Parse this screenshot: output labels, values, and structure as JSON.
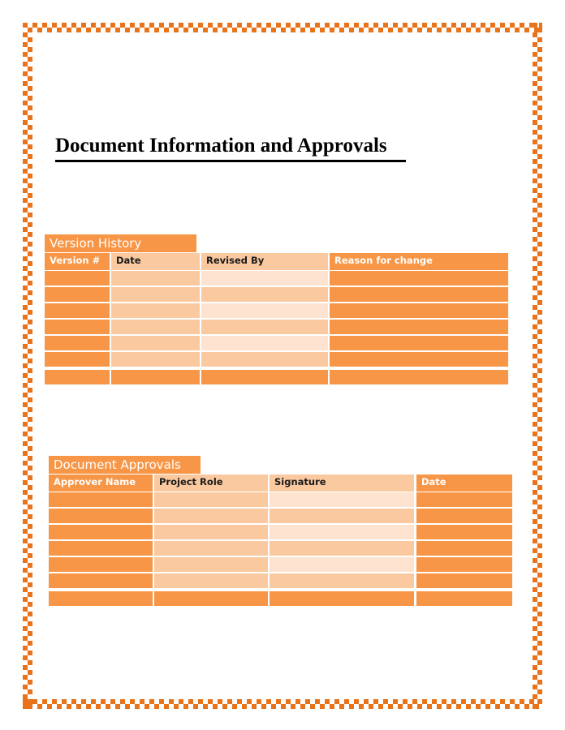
{
  "page": {
    "title": "Document Information and Approvals",
    "border_color": "#e8731a"
  },
  "colors": {
    "accent_dark": "#f79646",
    "accent_mid": "#fbc9a0",
    "accent_light": "#fde3d0"
  },
  "version_history": {
    "label": "Version History",
    "columns": [
      "Version #",
      "Date",
      "Revised By",
      "Reason for change"
    ],
    "rows": [
      [
        "",
        "",
        "",
        ""
      ],
      [
        "",
        "",
        "",
        ""
      ],
      [
        "",
        "",
        "",
        ""
      ],
      [
        "",
        "",
        "",
        ""
      ],
      [
        "",
        "",
        "",
        ""
      ],
      [
        "",
        "",
        "",
        ""
      ],
      [
        "",
        "",
        "",
        ""
      ]
    ]
  },
  "document_approvals": {
    "label": "Document Approvals",
    "columns": [
      "Approver Name",
      "Project Role",
      "Signature",
      "Date"
    ],
    "rows": [
      [
        "",
        "",
        "",
        ""
      ],
      [
        "",
        "",
        "",
        ""
      ],
      [
        "",
        "",
        "",
        ""
      ],
      [
        "",
        "",
        "",
        ""
      ],
      [
        "",
        "",
        "",
        ""
      ],
      [
        "",
        "",
        "",
        ""
      ],
      [
        "",
        "",
        "",
        ""
      ]
    ]
  }
}
